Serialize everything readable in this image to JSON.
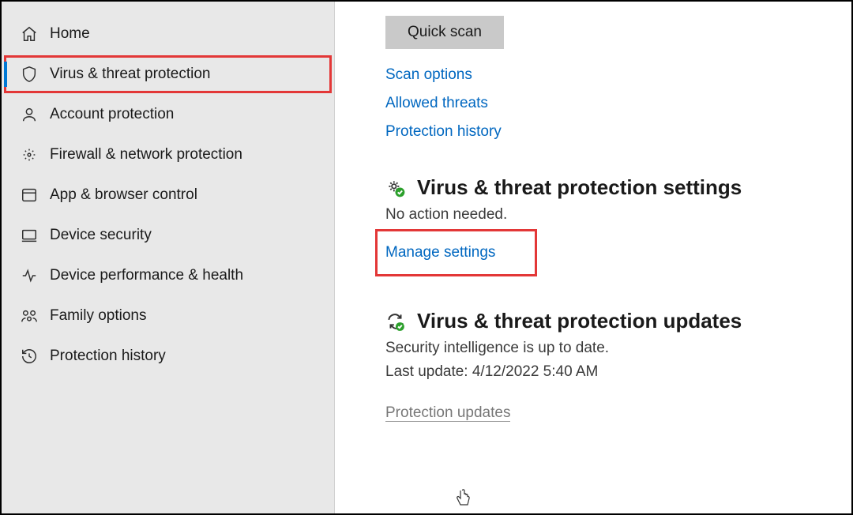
{
  "sidebar": {
    "items": [
      {
        "label": "Home"
      },
      {
        "label": "Virus & threat protection"
      },
      {
        "label": "Account protection"
      },
      {
        "label": "Firewall & network protection"
      },
      {
        "label": "App & browser control"
      },
      {
        "label": "Device security"
      },
      {
        "label": "Device performance & health"
      },
      {
        "label": "Family options"
      },
      {
        "label": "Protection history"
      }
    ]
  },
  "main": {
    "quick_scan": "Quick scan",
    "links": {
      "scan_options": "Scan options",
      "allowed_threats": "Allowed threats",
      "protection_history": "Protection history"
    },
    "settings_section": {
      "title": "Virus & threat protection settings",
      "status": "No action needed.",
      "manage_link": "Manage settings"
    },
    "updates_section": {
      "title": "Virus & threat protection updates",
      "status": "Security intelligence is up to date.",
      "last_update": "Last update: 4/12/2022 5:40 AM",
      "updates_link": "Protection updates"
    }
  }
}
